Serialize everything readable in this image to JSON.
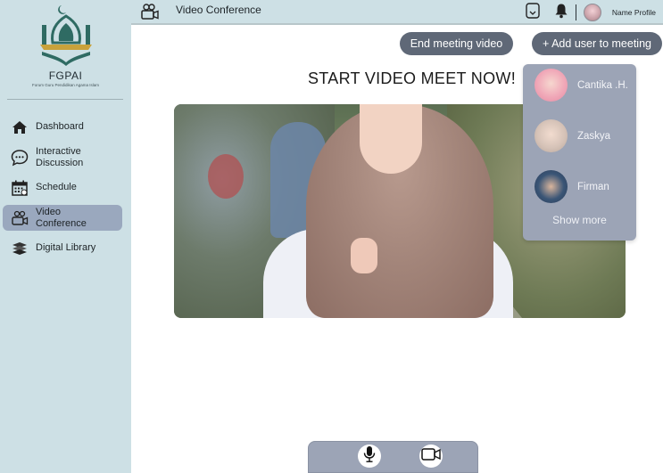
{
  "brand": {
    "name": "FGPAI",
    "subtitle": "Forum Guru Pendidikan Agama Islam"
  },
  "sidebar": {
    "items": [
      {
        "label": "Dashboard",
        "icon": "home-icon"
      },
      {
        "label": "Interactive\nDiscussion",
        "icon": "chat-icon"
      },
      {
        "label": "Schedule",
        "icon": "calendar-icon"
      },
      {
        "label": "Video\nConference",
        "icon": "video-conference-icon",
        "active": true
      },
      {
        "label": "Digital Library",
        "icon": "books-icon"
      }
    ]
  },
  "header": {
    "title": "Video Conference",
    "profile_name": "Name Profile",
    "icons": [
      "camera-icon",
      "bookmark-icon",
      "bell-icon",
      "avatar"
    ]
  },
  "actions": {
    "end_meeting": "End meeting video",
    "add_user": "+ Add user  to meeting"
  },
  "main": {
    "title": "START VIDEO MEET NOW!"
  },
  "add_user_dropdown": {
    "users": [
      {
        "name": "Cantika .H."
      },
      {
        "name": "Zaskya"
      },
      {
        "name": "Firman"
      }
    ],
    "show_more": "Show more"
  },
  "controls": {
    "icons": [
      "microphone-icon",
      "video-camera-icon"
    ]
  },
  "colors": {
    "sidebar_bg": "#cde0e5",
    "active_nav": "#9aa8be",
    "button_bg": "#5f6877",
    "dropdown_bg": "#9ca4b6",
    "logo_green": "#2f6b63",
    "logo_gold": "#c9a23b"
  }
}
